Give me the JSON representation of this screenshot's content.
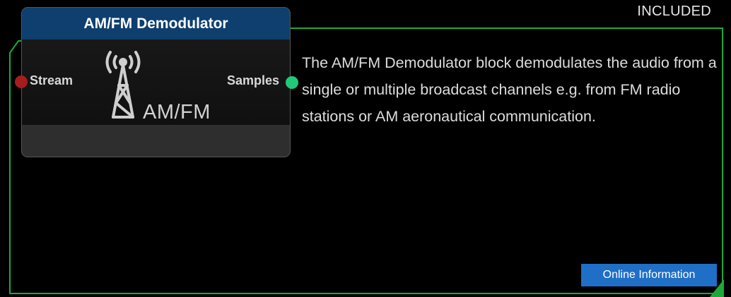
{
  "badge": "INCLUDED",
  "block": {
    "title": "AM/FM Demodulator",
    "input_port": "Stream",
    "output_port": "Samples",
    "logo_text": "AM/FM",
    "icon": "radio-tower-icon"
  },
  "description": "The AM/FM Demodulator block demodulates the audio from a single or multiple broadcast channels e.g. from FM radio stations or AM aeronautical communication.",
  "info_button": "Online Information",
  "colors": {
    "frame": "#1fa83a",
    "header": "#0e3f6e",
    "input_port": "#a51d1d",
    "output_port": "#1fc97a",
    "button": "#1f6fc6"
  }
}
